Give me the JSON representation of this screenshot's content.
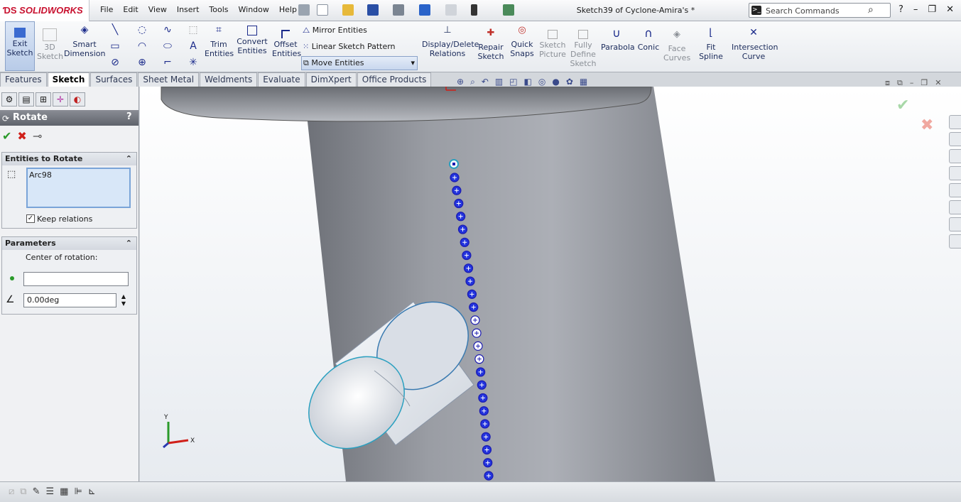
{
  "app": {
    "name": "SOLIDWORKS",
    "doc_title": "Sketch39 of Cyclone-Amira's *"
  },
  "menu": [
    "File",
    "Edit",
    "View",
    "Insert",
    "Tools",
    "Window",
    "Help"
  ],
  "search": {
    "placeholder": "Search Commands"
  },
  "ribbon": {
    "exit_sketch": "Exit Sketch",
    "sketch_3d": "3D Sketch",
    "smart_dimension": "Smart Dimension",
    "trim_entities": "Trim Entities",
    "convert_entities": "Convert Entities",
    "offset_entities": "Offset Entities",
    "mirror_entities": "Mirror Entities",
    "linear_pattern": "Linear Sketch Pattern",
    "move_entities": "Move Entities",
    "display_delete_relations": "Display/Delete Relations",
    "repair_sketch": "Repair Sketch",
    "quick_snaps": "Quick Snaps",
    "sketch_picture": "Sketch Picture",
    "fully_define_sketch": "Fully Define Sketch",
    "parabola": "Parabola",
    "conic": "Conic",
    "face_curves": "Face Curves",
    "fit_spline": "Fit Spline",
    "intersection_curve": "Intersection Curve"
  },
  "tabs": [
    {
      "label": "Features",
      "active": false
    },
    {
      "label": "Sketch",
      "active": true
    },
    {
      "label": "Surfaces",
      "active": false
    },
    {
      "label": "Sheet Metal",
      "active": false
    },
    {
      "label": "Weldments",
      "active": false
    },
    {
      "label": "Evaluate",
      "active": false
    },
    {
      "label": "DimXpert",
      "active": false
    },
    {
      "label": "Office Products",
      "active": false
    }
  ],
  "property_manager": {
    "title": "Rotate",
    "help": "?",
    "entities_box": {
      "title": "Entities to Rotate",
      "items": [
        "Arc98"
      ],
      "keep_relations_label": "Keep relations",
      "keep_relations": true
    },
    "parameters_box": {
      "title": "Parameters",
      "center_label": "Center of rotation:",
      "center_value": "",
      "angle_value": "0.00deg"
    }
  },
  "triad": {
    "x": "X",
    "y": "Y"
  },
  "colors": {
    "accent": "#2b3fb6",
    "sketch_points": "#1a1ad0",
    "ok_green": "#2a9a2a",
    "cancel_red": "#d0201a",
    "pm_header": "#6e727a"
  }
}
